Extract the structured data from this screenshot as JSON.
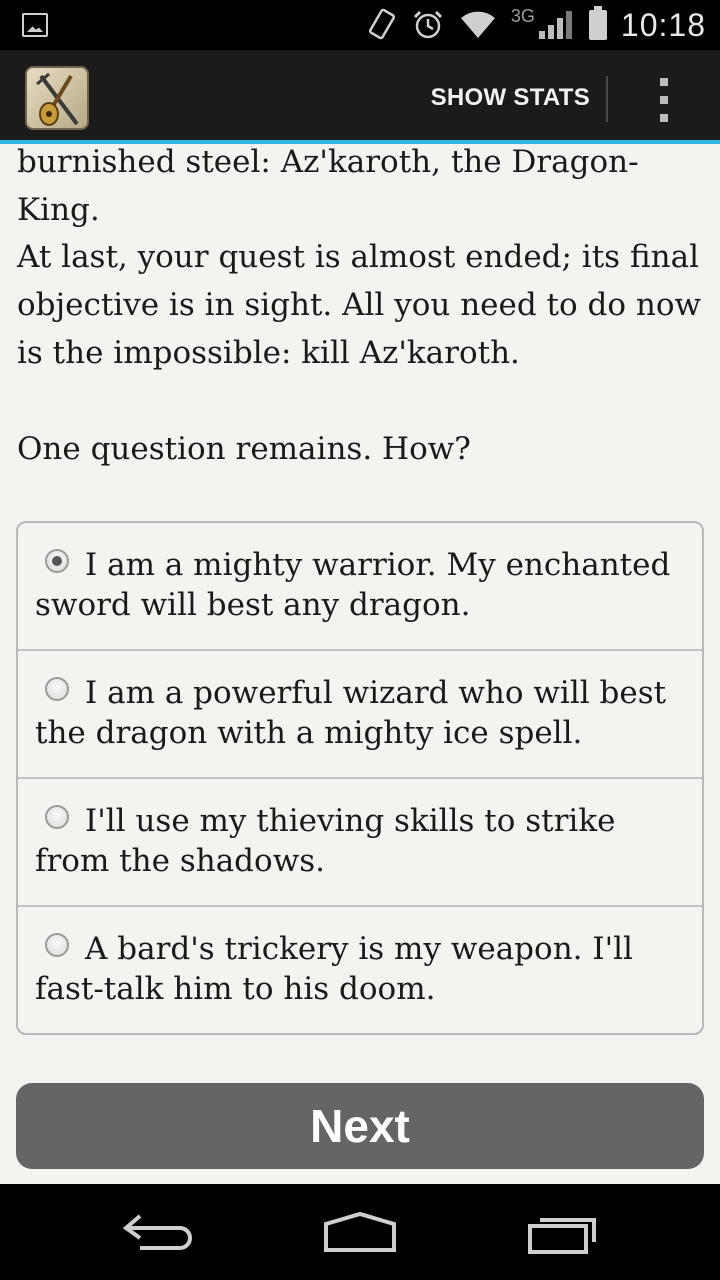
{
  "status_bar": {
    "network_label": "3G",
    "time": "10:18",
    "icons": [
      "gallery-icon",
      "rotate-icon",
      "alarm-icon",
      "wifi-icon",
      "signal-icon",
      "battery-icon"
    ]
  },
  "action_bar": {
    "app_icon": "sword-and-lute-app-icon",
    "show_stats_label": "SHOW STATS",
    "overflow_icon": "overflow-menu-icon",
    "accent_color": "#33b5e5"
  },
  "story": {
    "paragraphs": [
      "burnished steel: Az'karoth, the Dragon-King.",
      "At last, your quest is almost ended; its final objective is in sight. All you need to do now is the impossible: kill Az'karoth.",
      "One question remains. How?"
    ]
  },
  "choices": [
    {
      "label": "I am a mighty warrior. My enchanted sword will best any dragon.",
      "selected": true
    },
    {
      "label": "I am a powerful wizard who will best the dragon with a mighty ice spell.",
      "selected": false
    },
    {
      "label": "I'll use my thieving skills to strike from the shadows.",
      "selected": false
    },
    {
      "label": "A bard's trickery is my weapon. I'll fast-talk him to his doom.",
      "selected": false
    }
  ],
  "next_button_label": "Next",
  "nav_bar": {
    "icons": [
      "back-icon",
      "home-icon",
      "recent-apps-icon"
    ]
  }
}
